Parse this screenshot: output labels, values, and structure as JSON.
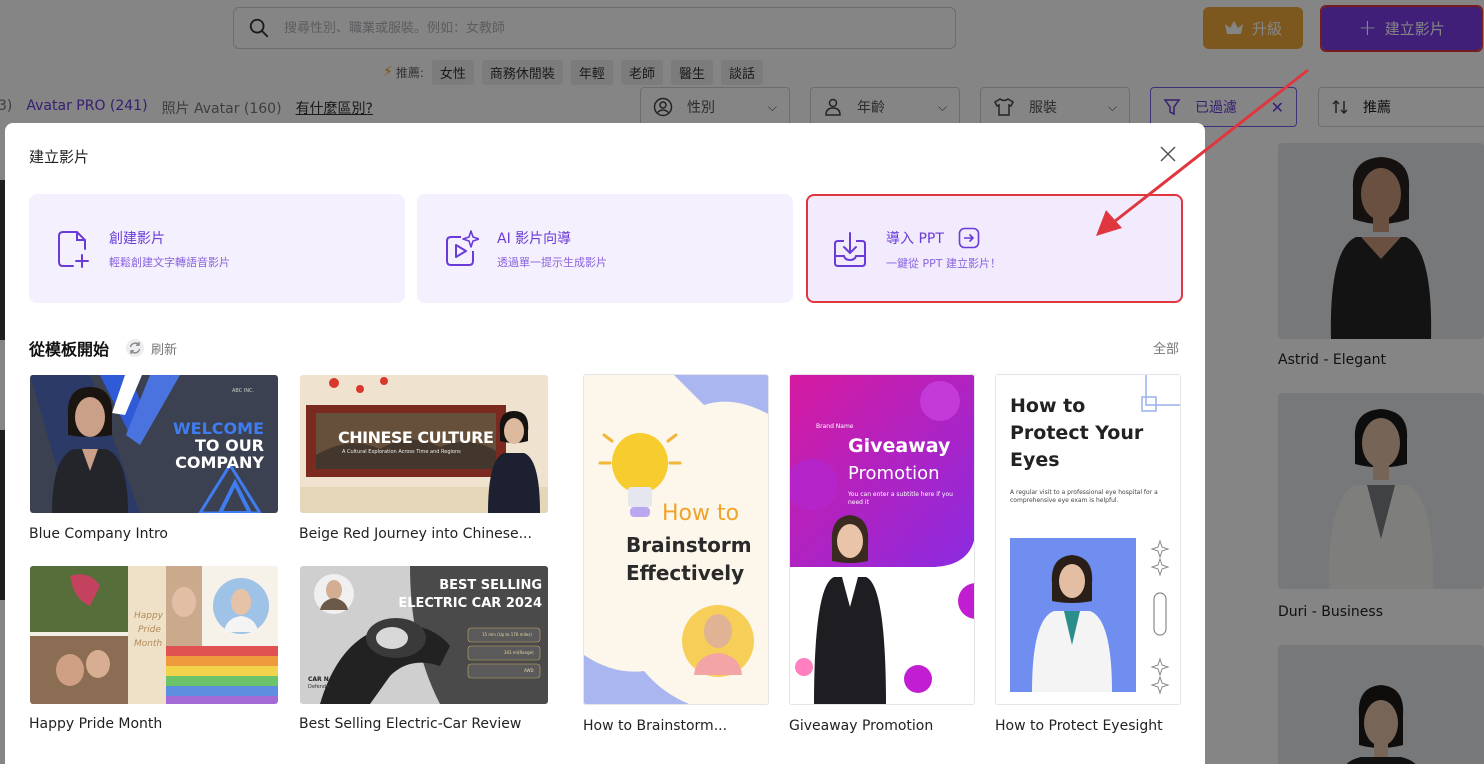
{
  "header": {
    "search_placeholder": "搜尋性別、職業或服裝。例如：女教師",
    "upgrade_label": "升級",
    "create_label": "建立影片"
  },
  "tags": {
    "recommend_label": "推薦:",
    "items": [
      "女性",
      "商務休閒裝",
      "年輕",
      "老師",
      "醫生",
      "談話"
    ]
  },
  "filters": {
    "tab_cut": "3)",
    "tab_pro": "Avatar PRO (241)",
    "tab_photo": "照片 Avatar (160)",
    "diff_link": "有什麼區別?",
    "gender": "性別",
    "age": "年齡",
    "clothing": "服裝",
    "filtered": "已過濾",
    "sort": "推薦"
  },
  "avatars": [
    {
      "name": "Astrid - Elegant"
    },
    {
      "name": "Duri - Business"
    }
  ],
  "modal": {
    "title": "建立影片",
    "options": [
      {
        "title": "創建影片",
        "desc": "輕鬆創建文字轉語音影片"
      },
      {
        "title": "AI 影片向導",
        "desc": "透過單一提示生成影片"
      },
      {
        "title": "導入 PPT",
        "desc": "一鍵從 PPT 建立影片！"
      }
    ],
    "section_title": "從模板開始",
    "refresh_label": "刷新",
    "view_all": "全部",
    "templates": [
      {
        "name": "Blue Company Intro",
        "thumb_lines": [
          "WELCOME",
          "TO OUR",
          "COMPANY"
        ],
        "small": "ABC INC."
      },
      {
        "name": "Beige Red Journey into Chinese...",
        "thumb_lines": [
          "CHINESE CULTURE"
        ],
        "small": "A Cultural Exploration Across Time and Regions"
      },
      {
        "name": "How to Brainstorm...",
        "thumb_lines": [
          "How to",
          "Brainstorm",
          "Effectively"
        ]
      },
      {
        "name": "Giveaway Promotion",
        "thumb_lines": [
          "Giveaway",
          "Promotion"
        ],
        "small": "Brand Name",
        "sub": "You can enter a subtitle here if you need it"
      },
      {
        "name": "How to Protect Eyesight",
        "thumb_lines": [
          "How to",
          "Protect Your",
          "Eyes"
        ],
        "sub": "A regular visit to a professional eye hospital for a comprehensive eye exam is helpful."
      },
      {
        "name": "Happy Pride Month",
        "thumb_lines": [
          "Happy",
          "Pride",
          "Month"
        ]
      },
      {
        "name": "Best Selling Electric-Car Review",
        "thumb_lines": [
          "BEST SELLING",
          "ELECTRIC CAR 2024"
        ],
        "stats": [
          "15 min (Up to 176 miles)",
          "341 mi(Range)",
          "AWD"
        ],
        "car_name": "CAR NAME",
        "car_sub": "Defender"
      }
    ]
  },
  "colors": {
    "accent": "#7b3ce8",
    "upgrade": "#f0a93a",
    "highlight": "#e0373f"
  }
}
